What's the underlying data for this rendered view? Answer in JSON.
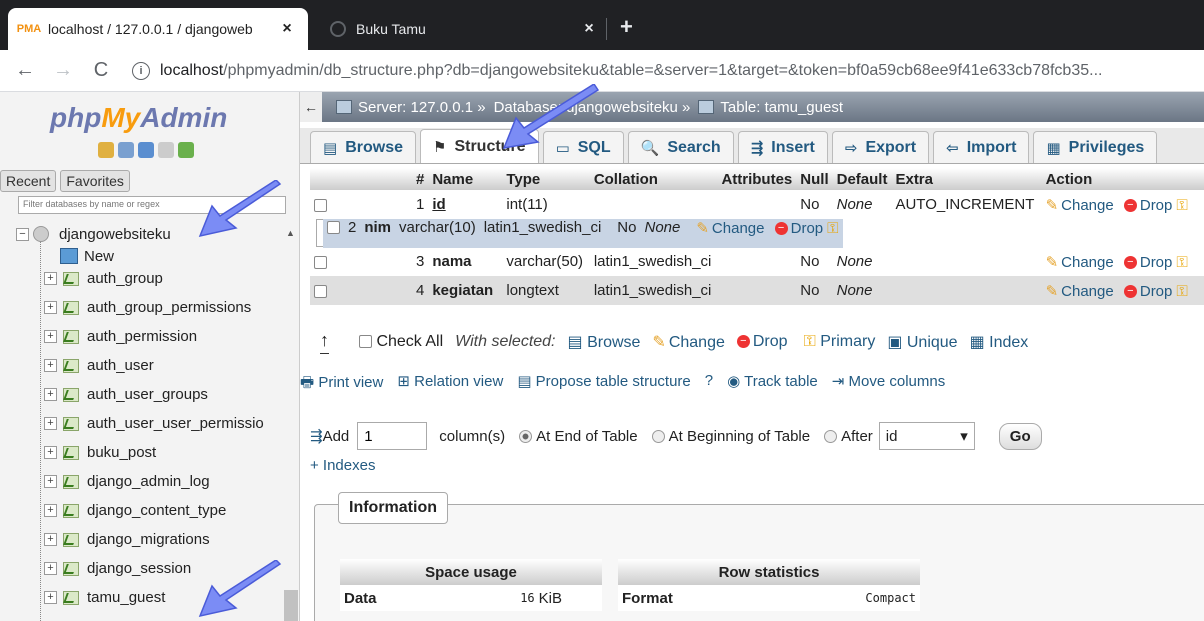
{
  "browser": {
    "tabs": [
      {
        "title": "localhost / 127.0.0.1 / djangoweb",
        "favicon": "phpmyadmin-icon",
        "fav_text": "PMA",
        "active": true
      },
      {
        "title": "Buku Tamu",
        "favicon": "globe-icon",
        "active": false
      }
    ],
    "close_glyph": "×",
    "new_tab": "+",
    "back": "←",
    "forward": "→",
    "reload": "C",
    "info": "i",
    "url_host": "localhost",
    "url_rest": "/phpmyadmin/db_structure.php?db=djangowebsiteku&table=&server=1&target=&token=bf0a59cb68ee9f41e633cb78fcb35..."
  },
  "sidebar": {
    "logo": {
      "php": "php",
      "my": "My",
      "admin": "Admin"
    },
    "recent": "Recent",
    "favorites": "Favorites",
    "filter_placeholder": "Filter databases by name or regex",
    "database": "djangowebsiteku",
    "new_label": "New",
    "tables": [
      "auth_group",
      "auth_group_permissions",
      "auth_permission",
      "auth_user",
      "auth_user_groups",
      "auth_user_user_permissio",
      "buku_post",
      "django_admin_log",
      "django_content_type",
      "django_migrations",
      "django_session",
      "tamu_guest"
    ],
    "plus": "+"
  },
  "breadcrumb": {
    "back": "←",
    "server": "Server: 127.0.0.1 »",
    "database": "Database: djangowebsiteku »",
    "table": "Table: tamu_guest"
  },
  "main_tabs": [
    {
      "label": "Browse",
      "icon": "▤"
    },
    {
      "label": "Structure",
      "icon": "⚑"
    },
    {
      "label": "SQL",
      "icon": "▭"
    },
    {
      "label": "Search",
      "icon": "🔍"
    },
    {
      "label": "Insert",
      "icon": "⇶"
    },
    {
      "label": "Export",
      "icon": "⇨"
    },
    {
      "label": "Import",
      "icon": "⇦"
    },
    {
      "label": "Privileges",
      "icon": "▦"
    }
  ],
  "structure": {
    "headers": [
      "#",
      "Name",
      "Type",
      "Collation",
      "Attributes",
      "Null",
      "Default",
      "Extra",
      "Action"
    ],
    "rows": [
      {
        "num": "1",
        "name": "id",
        "type": "int(11)",
        "collation": "",
        "attributes": "",
        "null": "No",
        "default": "None",
        "extra": "AUTO_INCREMENT"
      },
      {
        "num": "2",
        "name": "nim",
        "type": "varchar(10)",
        "collation": "latin1_swedish_ci",
        "attributes": "",
        "null": "No",
        "default": "None",
        "extra": ""
      },
      {
        "num": "3",
        "name": "nama",
        "type": "varchar(50)",
        "collation": "latin1_swedish_ci",
        "attributes": "",
        "null": "No",
        "default": "None",
        "extra": ""
      },
      {
        "num": "4",
        "name": "kegiatan",
        "type": "longtext",
        "collation": "latin1_swedish_ci",
        "attributes": "",
        "null": "No",
        "default": "None",
        "extra": ""
      }
    ],
    "change": "Change",
    "drop": "Drop"
  },
  "with_selected": {
    "check_all": "Check All",
    "label": "With selected:",
    "browse": "Browse",
    "change": "Change",
    "drop": "Drop",
    "primary": "Primary",
    "unique": "Unique",
    "index": "Index"
  },
  "actions": {
    "print_view": "Print view",
    "relation_view": "Relation view",
    "propose": "Propose table structure",
    "track": "Track table",
    "move": "Move columns"
  },
  "add_columns": {
    "add": "Add",
    "count": "1",
    "columns_label": "column(s)",
    "at_end": "At End of Table",
    "at_beginning": "At Beginning of Table",
    "after": "After",
    "after_value": "id",
    "go": "Go",
    "indexes": "+ Indexes"
  },
  "information": {
    "legend": "Information",
    "space_usage": "Space usage",
    "row_statistics": "Row statistics",
    "data_label": "Data",
    "data_value": "16",
    "data_unit": "KiB",
    "format_label": "Format",
    "format_value": "Compact"
  },
  "colors": {
    "accent_link": "#235a81",
    "logo_orange": "#f89c0e",
    "logo_blue": "#6c78af",
    "pointer": "#7b8cf5"
  }
}
